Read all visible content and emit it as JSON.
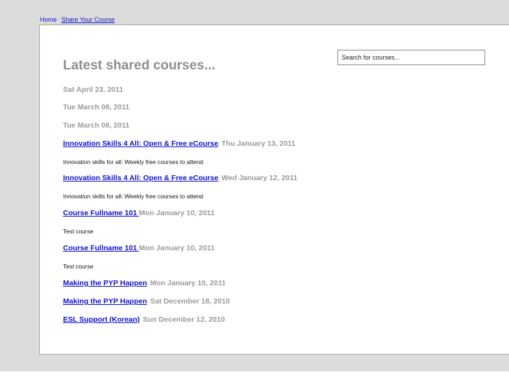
{
  "nav": {
    "home": "Home",
    "share": "Share Your Course"
  },
  "search": {
    "placeholder": "Search for courses..."
  },
  "heading": "Latest shared courses...",
  "entries": [
    {
      "date": "Sat April 23, 2011"
    },
    {
      "date": "Tue March 08, 2011"
    },
    {
      "date": "Tue March 08, 2011"
    },
    {
      "title": "Innovation Skills 4 All: Open & Free eCourse",
      "date": "Thu January 13, 2011",
      "description": "Innovation skills for all: Weekly free courses to attend"
    },
    {
      "title": "Innovation Skills 4 All: Open & Free eCourse",
      "date": "Wed January 12, 2011",
      "description": "Innovation skills for all: Weekly free courses to attend"
    },
    {
      "title": "Course Fullname 101 ",
      "date": "Mon January 10, 2011",
      "description": "Test course"
    },
    {
      "title": "Course Fullname 101 ",
      "date": "Mon January 10, 2011",
      "description": "Test course"
    },
    {
      "title": "Making the PYP Happen",
      "date": "Mon January 10, 2011"
    },
    {
      "title": "Making the PYP Happen",
      "date": "Sat December 18, 2010"
    },
    {
      "title": "ESL Support (Korean)",
      "date": "Sun December 12, 2010"
    }
  ],
  "colors": {
    "link": "#1010d0",
    "muted": "#9a9a9a",
    "page_bg": "#dcdcdc"
  }
}
